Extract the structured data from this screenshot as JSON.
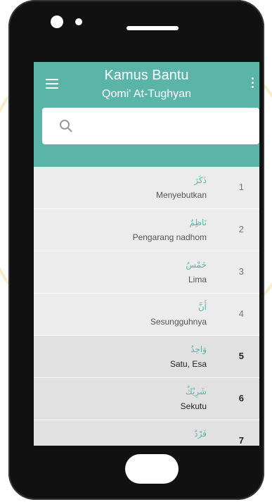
{
  "app": {
    "title": "Kamus Bantu",
    "subtitle": "Qomi' At-Tughyan"
  },
  "search": {
    "placeholder": "",
    "value": ""
  },
  "entries": [
    {
      "arabic": "ذَكَرَ",
      "meaning": "Menyebutkan",
      "number": "1"
    },
    {
      "arabic": "نَاظِمٌ",
      "meaning": "Pengarang nadhom",
      "number": "2"
    },
    {
      "arabic": "خَمْسٌ",
      "meaning": "Lima",
      "number": "3"
    },
    {
      "arabic": "أَنَّ",
      "meaning": "Sesungguhnya",
      "number": "4"
    },
    {
      "arabic": "وَاحِدٌ",
      "meaning": "Satu, Esa",
      "number": "5"
    },
    {
      "arabic": "شَرِيْكٌ",
      "meaning": "Sekutu",
      "number": "6"
    },
    {
      "arabic": "فَرْدٌ",
      "meaning": "",
      "number": "7"
    }
  ],
  "colors": {
    "accent": "#5ab5a8",
    "watermark": "#e8d27a"
  }
}
